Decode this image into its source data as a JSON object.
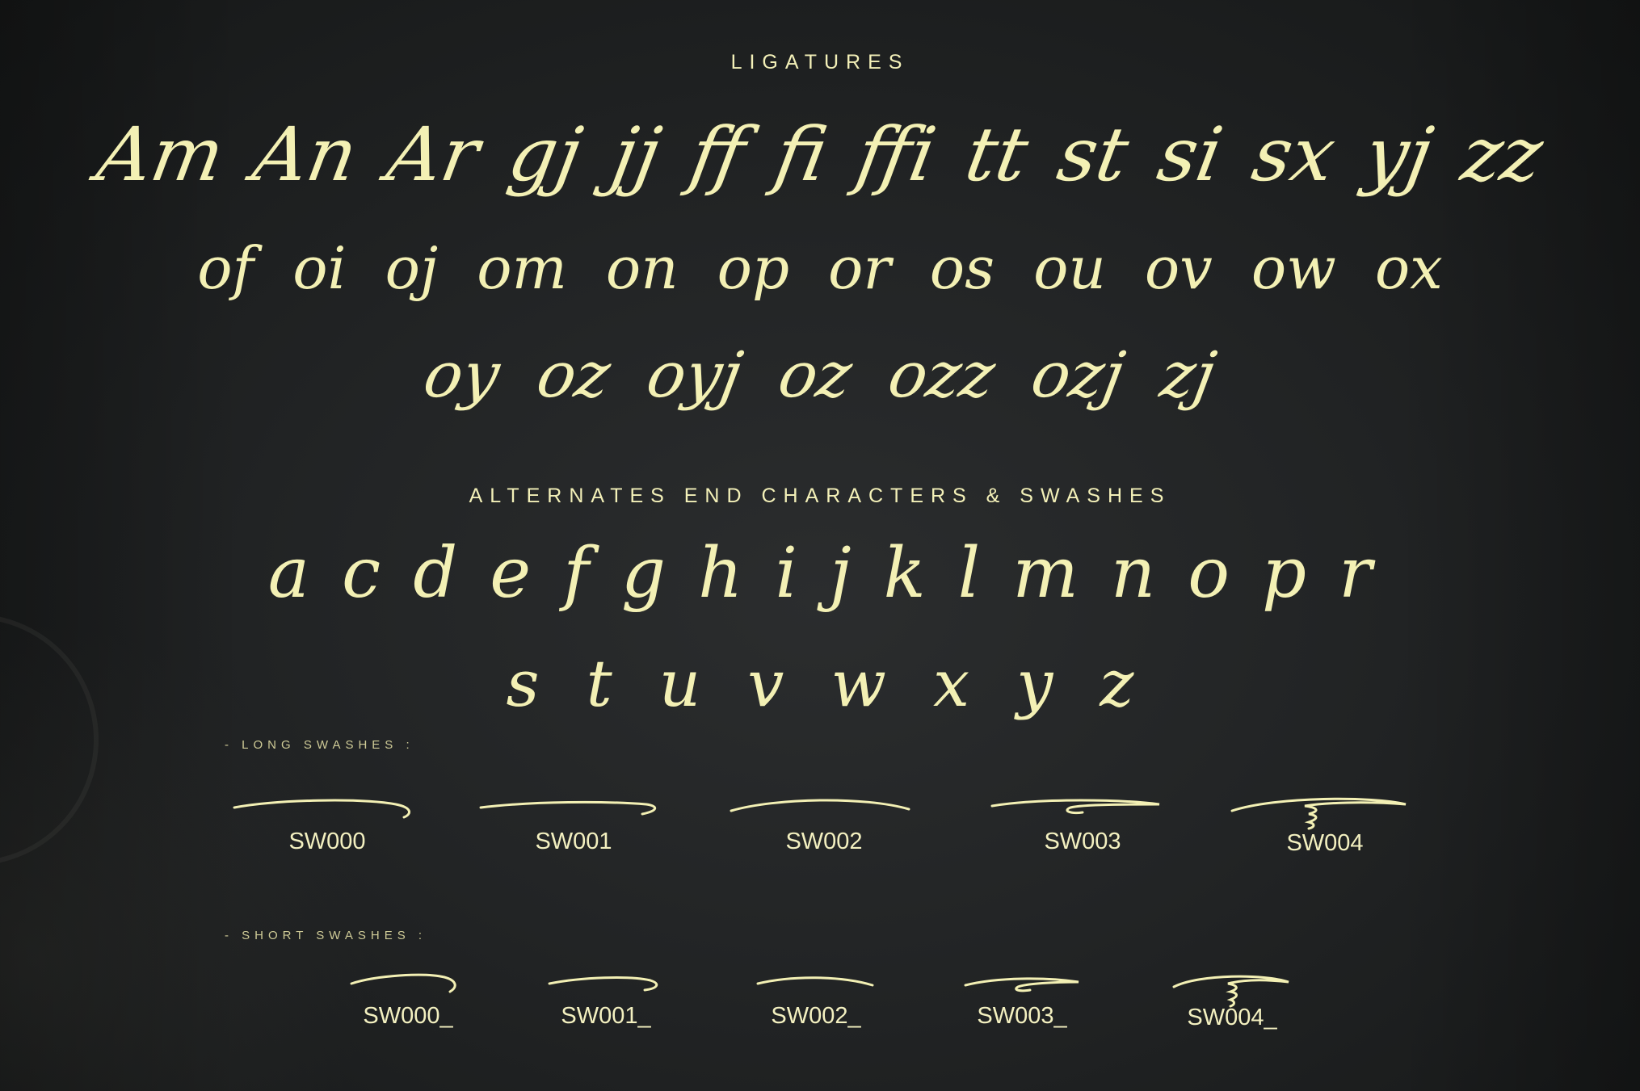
{
  "headings": {
    "ligatures": "LIGATURES",
    "alternates": "ALTERNATES END CHARACTERS & SWASHES",
    "long_swashes": "- LONG SWASHES :",
    "short_swashes": "- SHORT SWASHES :"
  },
  "ligatures": {
    "row1": [
      "Am",
      "An",
      "Ar",
      "gj",
      "jj",
      "ff",
      "fi",
      "ffi",
      "tt",
      "st",
      "si",
      "sx",
      "yj",
      "zz"
    ],
    "row2": [
      "of",
      "oi",
      "oj",
      "om",
      "on",
      "op",
      "or",
      "os",
      "ou",
      "ov",
      "ow",
      "ox"
    ],
    "row3": [
      "oy",
      "oz",
      "oyj",
      "oz",
      "ozz",
      "ozj",
      "zj"
    ]
  },
  "alternates": {
    "row1": [
      "a",
      "c",
      "d",
      "e",
      "f",
      "g",
      "h",
      "i",
      "j",
      "k",
      "l",
      "m",
      "n",
      "o",
      "p",
      "r"
    ],
    "row2": [
      "s",
      "t",
      "u",
      "v",
      "w",
      "x",
      "y",
      "z"
    ]
  },
  "long_swashes": [
    "SW000",
    "SW001",
    "SW002",
    "SW003",
    "SW004"
  ],
  "short_swashes": [
    "SW000_",
    "SW001_",
    "SW002_",
    "SW003_",
    "SW004_"
  ],
  "colors": {
    "background": "#1f2122",
    "ink": "#f3f0b4"
  }
}
